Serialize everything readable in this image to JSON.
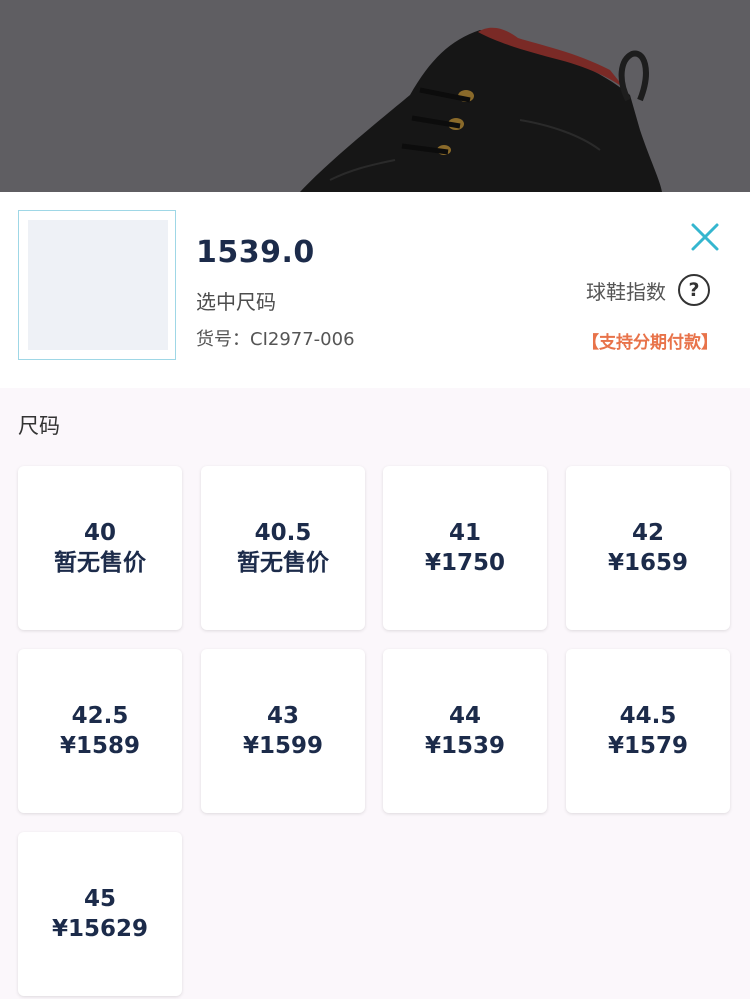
{
  "header": {
    "price": "1539.0",
    "selected_label": "选中尺码",
    "item_number": "货号：CI2977-006",
    "shoe_index_label": "球鞋指数",
    "help_glyph": "?",
    "installment_label": "【支持分期付款】"
  },
  "sizes_section": {
    "title": "尺码",
    "items": [
      {
        "size": "40",
        "price": "暂无售价"
      },
      {
        "size": "40.5",
        "price": "暂无售价"
      },
      {
        "size": "41",
        "price": "¥1750"
      },
      {
        "size": "42",
        "price": "¥1659"
      },
      {
        "size": "42.5",
        "price": "¥1589"
      },
      {
        "size": "43",
        "price": "¥1599"
      },
      {
        "size": "44",
        "price": "¥1539"
      },
      {
        "size": "44.5",
        "price": "¥1579"
      },
      {
        "size": "45",
        "price": "¥15629"
      }
    ]
  },
  "colors": {
    "accent_close": "#35b6cf",
    "installment": "#e8734a",
    "text_dark": "#1c2b4a"
  },
  "icons": {
    "close": "close-icon",
    "help": "question-circle-icon"
  }
}
